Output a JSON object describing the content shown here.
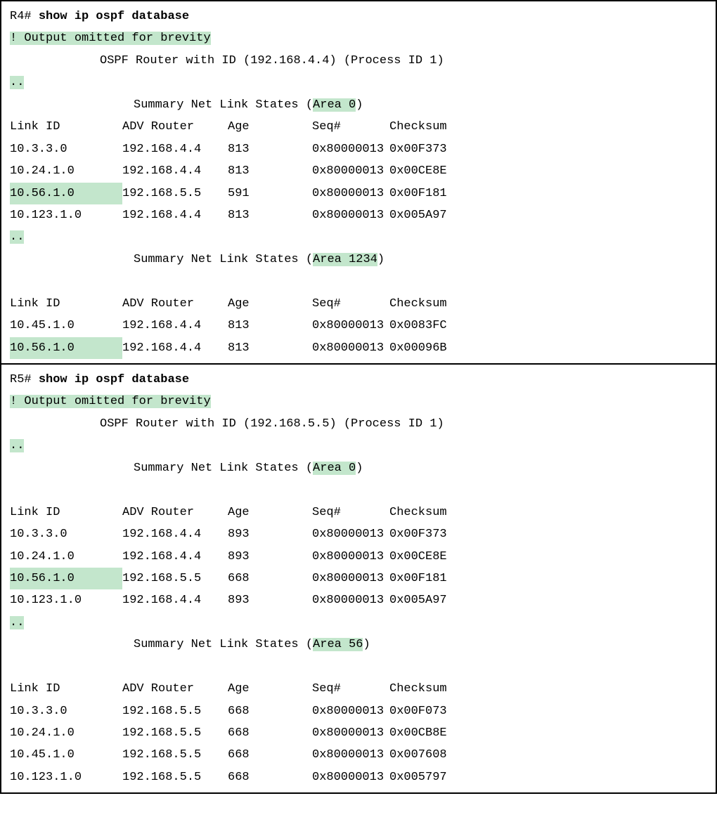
{
  "panels": [
    {
      "prompt": "R4# ",
      "command": "show ip ospf database",
      "omitted": "! Output omitted for brevity",
      "header": "OSPF Router with ID (192.168.4.4) (Process ID 1)",
      "ellipsis": "..",
      "sections": [
        {
          "title_prefix": "Summary Net Link States (",
          "area_label": "Area 0",
          "title_suffix": ")",
          "cols": {
            "link": "Link ID",
            "adv": "ADV Router",
            "age": "Age",
            "seq": "Seq#",
            "chk": "Checksum"
          },
          "rows": [
            {
              "link": "10.3.3.0",
              "adv": "192.168.4.4",
              "age": "813",
              "seq": "0x80000013",
              "chk": "0x00F373",
              "hl": false
            },
            {
              "link": "10.24.1.0",
              "adv": "192.168.4.4",
              "age": "813",
              "seq": "0x80000013",
              "chk": "0x00CE8E",
              "hl": false
            },
            {
              "link": "10.56.1.0",
              "adv": "192.168.5.5",
              "age": "591",
              "seq": "0x80000013",
              "chk": "0x00F181",
              "hl": true
            },
            {
              "link": "10.123.1.0",
              "adv": "192.168.4.4",
              "age": "813",
              "seq": "0x80000013",
              "chk": "0x005A97",
              "hl": false
            }
          ],
          "trailing_ellipsis": true
        },
        {
          "title_prefix": "Summary Net Link States (",
          "area_label": "Area 1234",
          "title_suffix": ")",
          "blank_before_cols": true,
          "cols": {
            "link": "Link ID",
            "adv": "ADV Router",
            "age": "Age",
            "seq": "Seq#",
            "chk": "Checksum"
          },
          "rows": [
            {
              "link": "10.45.1.0",
              "adv": "192.168.4.4",
              "age": "813",
              "seq": "0x80000013",
              "chk": "0x0083FC",
              "hl": false
            },
            {
              "link": "10.56.1.0",
              "adv": "192.168.4.4",
              "age": "813",
              "seq": "0x80000013",
              "chk": "0x00096B",
              "hl": true
            }
          ],
          "trailing_ellipsis": false
        }
      ]
    },
    {
      "prompt": "R5# ",
      "command": "show ip ospf database",
      "omitted": "! Output omitted for brevity",
      "header": "OSPF Router with ID (192.168.5.5) (Process ID 1)",
      "ellipsis": "..",
      "sections": [
        {
          "title_prefix": "Summary Net Link States (",
          "area_label": "Area 0",
          "title_suffix": ")",
          "blank_before_cols": true,
          "cols": {
            "link": "Link ID",
            "adv": "ADV Router",
            "age": "Age",
            "seq": "Seq#",
            "chk": "Checksum"
          },
          "rows": [
            {
              "link": "10.3.3.0",
              "adv": "192.168.4.4",
              "age": "893",
              "seq": "0x80000013",
              "chk": "0x00F373",
              "hl": false
            },
            {
              "link": "10.24.1.0",
              "adv": "192.168.4.4",
              "age": "893",
              "seq": "0x80000013",
              "chk": "0x00CE8E",
              "hl": false
            },
            {
              "link": "10.56.1.0",
              "adv": "192.168.5.5",
              "age": "668",
              "seq": "0x80000013",
              "chk": "0x00F181",
              "hl": true
            },
            {
              "link": "10.123.1.0",
              "adv": "192.168.4.4",
              "age": "893",
              "seq": "0x80000013",
              "chk": "0x005A97",
              "hl": false
            }
          ],
          "trailing_ellipsis": true
        },
        {
          "title_prefix": "Summary Net Link States (",
          "area_label": "Area 56",
          "title_suffix": ")",
          "blank_before_cols": true,
          "cols": {
            "link": "Link ID",
            "adv": "ADV Router",
            "age": "Age",
            "seq": "Seq#",
            "chk": "Checksum"
          },
          "rows": [
            {
              "link": "10.3.3.0",
              "adv": "192.168.5.5",
              "age": "668",
              "seq": "0x80000013",
              "chk": "0x00F073",
              "hl": false
            },
            {
              "link": "10.24.1.0",
              "adv": "192.168.5.5",
              "age": "668",
              "seq": "0x80000013",
              "chk": "0x00CB8E",
              "hl": false
            },
            {
              "link": "10.45.1.0",
              "adv": "192.168.5.5",
              "age": "668",
              "seq": "0x80000013",
              "chk": "0x007608",
              "hl": false
            },
            {
              "link": "10.123.1.0",
              "adv": "192.168.5.5",
              "age": "668",
              "seq": "0x80000013",
              "chk": "0x005797",
              "hl": false
            }
          ],
          "trailing_ellipsis": false
        }
      ]
    }
  ]
}
